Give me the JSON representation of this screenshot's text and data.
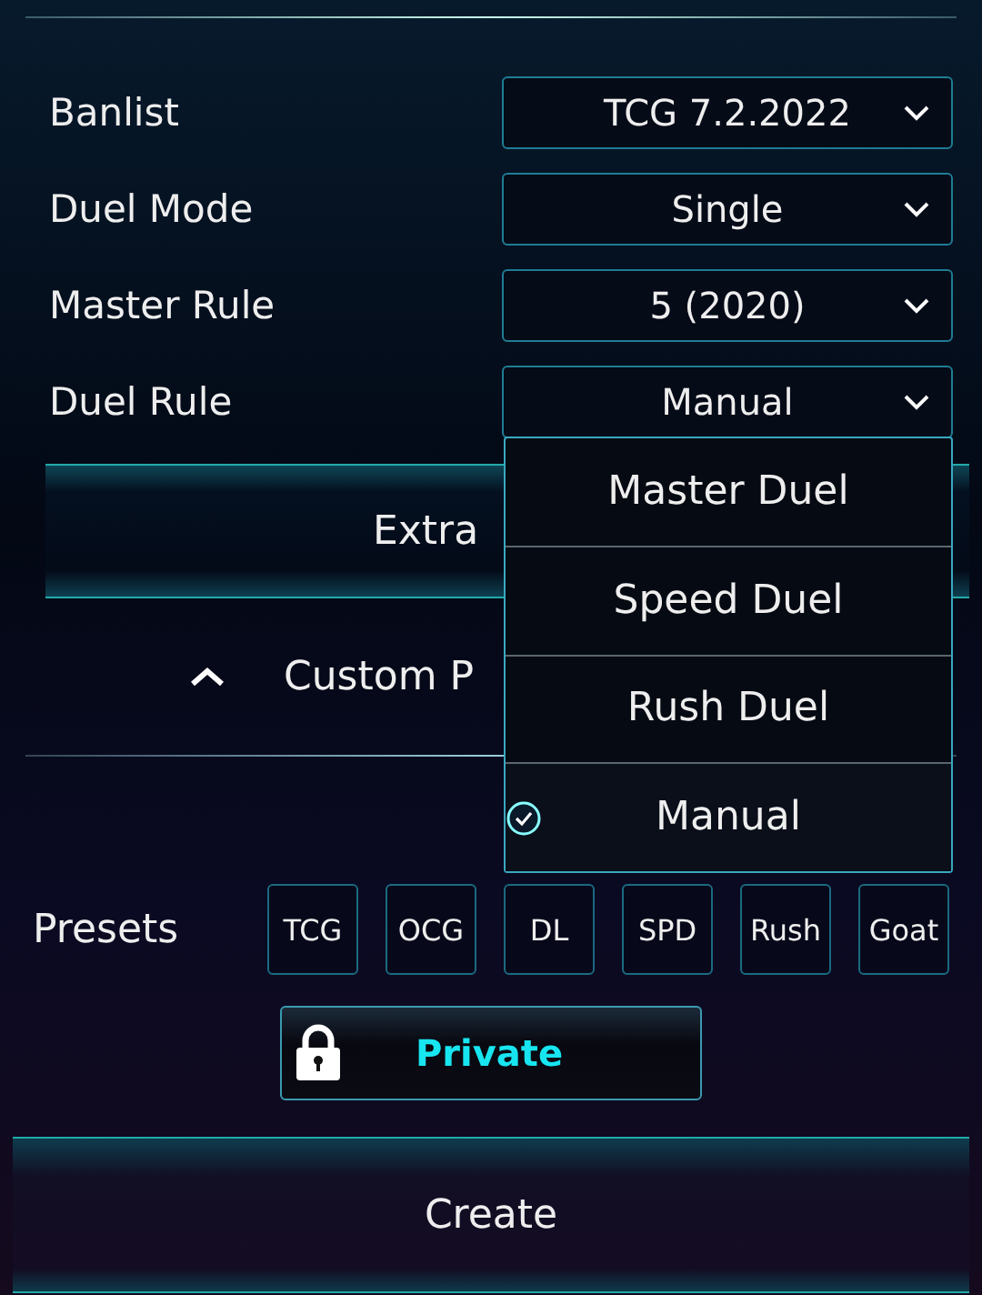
{
  "settings": [
    {
      "label": "Banlist",
      "value": "TCG 7.2.2022"
    },
    {
      "label": "Duel Mode",
      "value": "Single"
    },
    {
      "label": "Master Rule",
      "value": "5 (2020)"
    },
    {
      "label": "Duel Rule",
      "value": "Manual"
    }
  ],
  "dropdown_options": [
    {
      "label": "Master Duel",
      "selected": false
    },
    {
      "label": "Speed Duel",
      "selected": false
    },
    {
      "label": "Rush Duel",
      "selected": false
    },
    {
      "label": "Manual",
      "selected": true
    }
  ],
  "extra_button": "Extra",
  "custom_section": {
    "label": "Custom P",
    "expanded": true
  },
  "presets": {
    "label": "Presets",
    "items": [
      "TCG",
      "OCG",
      "DL",
      "SPD",
      "Rush",
      "Goat"
    ]
  },
  "private_button": {
    "label": "Private",
    "locked": true
  },
  "create_button": "Create"
}
